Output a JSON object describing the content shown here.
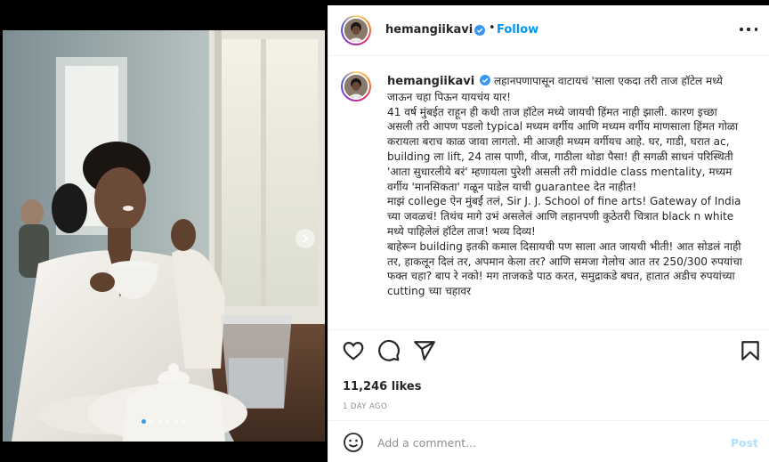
{
  "post": {
    "username": "hemangiikavi",
    "follow_label": "Follow",
    "bullet": "•",
    "caption_text": "लहानपणापासून वाटायचं 'साला एकदा तरी ताज हॉटेल मध्ये जाऊन चहा पिऊन यायचंय यार!\n41 वर्ष मुंबईत राहून ही कधी ताज हॉटेल मध्ये जायची हिंमत नाही झाली. कारण इच्छा असली तरी आपण पडलो typical मध्यम वर्गीय आणि मध्यम वर्गीय माणसाला हिंमत गोळा करायला बराच काळ जावा लागतो. मी आजही मध्यम वर्गीयच आहे. घर, गाडी, घरात ac, building ला lift, 24 तास पाणी, वीज, गाठीला थोडा पैसा! ही सगळी साधनं परिस्थिती 'आता सुधारलीये बरं' म्हणायला पुरेशी असली तरी middle class mentality, मध्यम वर्गीय 'मानसिकता' गळून पाडेल याची guarantee देत नाहीत!\nमाझं college ऐन मुंबईं तलं, Sir J. J. School of fine arts! Gateway of India च्या जवळचं! तिथंच मागे उभं असलेलं आणि लहानपणी कुठेतरी चित्रात black n white मध्ये पाहिलेलं हॉटेल ताज! भव्य दिव्य!\nबाहेरून building इतकी कमाल दिसायची पण साला आत जायची भीती! आत सोडलं नाही तर, हाकलून दिलं तर, अपमान केला तर? आणि समजा गेलोच आत तर 250/300 रुपयांचा फक्त चहा? बाप रे नको! मग ताजकडे पाठ करत, समुद्राकडे बघत, हातात अडीच रुपयांच्या cutting च्या चहावर",
    "likes": "11,246 likes",
    "time_ago": "1 DAY AGO"
  },
  "comment_box": {
    "placeholder": "Add a comment...",
    "post_label": "Post"
  },
  "carousel": {
    "slides": 6,
    "active_index": 0
  },
  "icons": {
    "verified": "verified-badge-icon",
    "more": "more-options-icon",
    "like": "heart-icon",
    "comment": "comment-icon",
    "share": "share-icon",
    "save": "bookmark-icon",
    "emoji": "emoji-icon",
    "next": "chevron-right-icon"
  },
  "colors": {
    "accent": "#0095f6",
    "verified": "#3897f0",
    "post_disabled": "#b2dffc",
    "muted": "#8e8e8e",
    "text": "#262626"
  }
}
